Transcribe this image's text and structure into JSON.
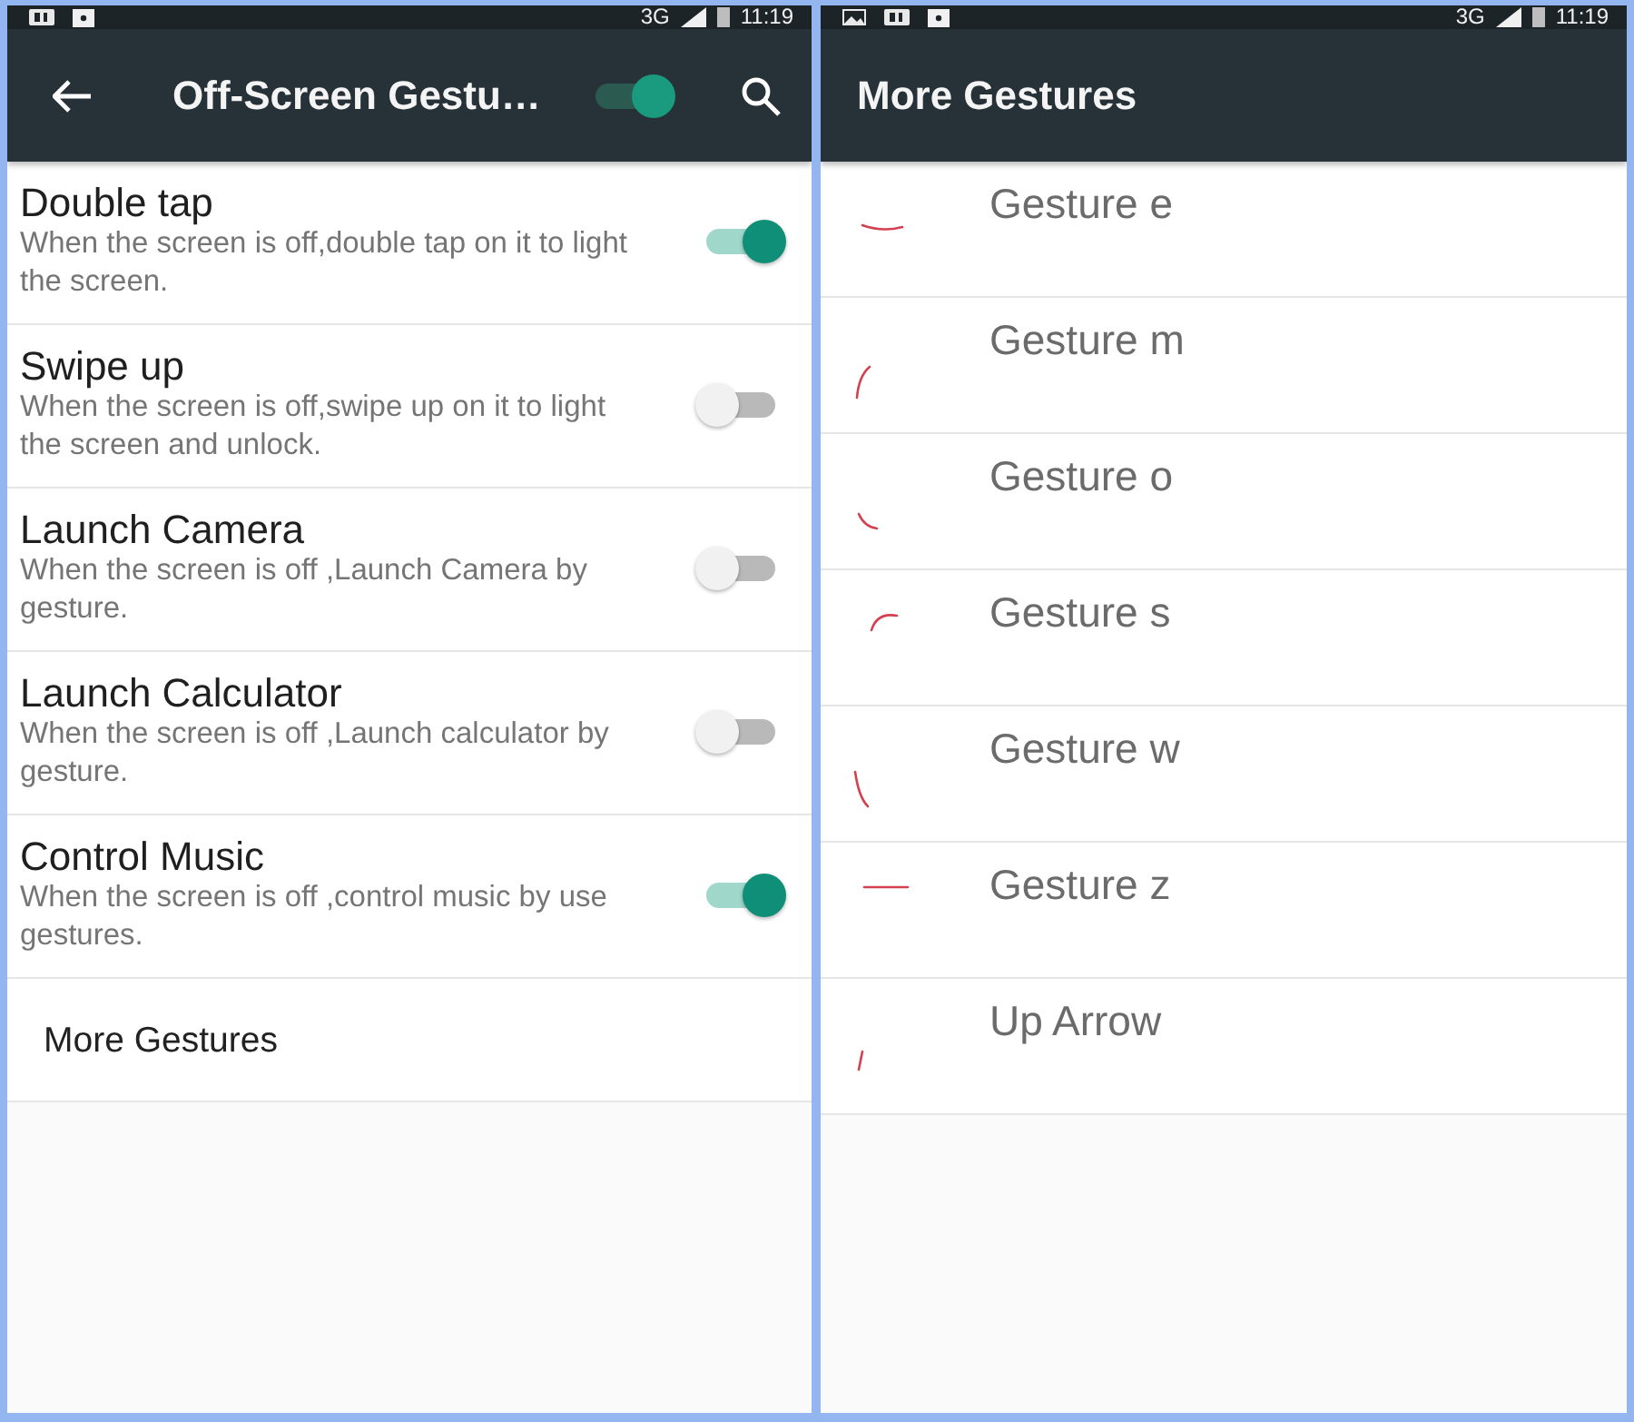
{
  "left_screen": {
    "status_bar": {
      "network": "3G",
      "time": "11:19"
    },
    "toolbar": {
      "title": "Off-Screen Gestu…",
      "switch_on": true
    },
    "settings": [
      {
        "title": "Double tap",
        "description": "When the screen is off,double tap on it to light the screen.",
        "on": true
      },
      {
        "title": "Swipe up",
        "description": "When the screen is off,swipe up on it to light the screen and unlock.",
        "on": false
      },
      {
        "title": "Launch Camera",
        "description": "When the screen is off ,Launch Camera by gesture.",
        "on": false
      },
      {
        "title": "Launch Calculator",
        "description": "When the screen is off ,Launch calculator by gesture.",
        "on": false
      },
      {
        "title": "Control Music",
        "description": "When the screen is off ,control music by use gestures.",
        "on": true
      }
    ],
    "more_link": "More Gestures"
  },
  "right_screen": {
    "status_bar": {
      "network": "3G",
      "time": "11:19"
    },
    "toolbar": {
      "title": "More Gestures"
    },
    "gestures": [
      {
        "label": "Gesture e"
      },
      {
        "label": "Gesture m"
      },
      {
        "label": "Gesture o"
      },
      {
        "label": "Gesture s"
      },
      {
        "label": "Gesture w"
      },
      {
        "label": "Gesture z"
      },
      {
        "label": "Up Arrow"
      }
    ]
  }
}
